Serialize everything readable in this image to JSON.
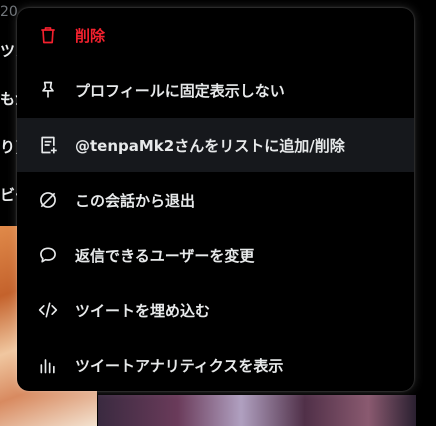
{
  "background": {
    "text_fragments": [
      "20",
      "ツン",
      "もか",
      "り)フ",
      "ビー"
    ]
  },
  "menu": {
    "items": [
      {
        "label": "削除",
        "icon": "trash-icon",
        "danger": true
      },
      {
        "label": "プロフィールに固定表示しない",
        "icon": "pin-icon"
      },
      {
        "label": "@tenpaMk2さんをリストに追加/削除",
        "icon": "list-add-icon",
        "hovered": true
      },
      {
        "label": "この会話から退出",
        "icon": "leave-conversation-icon"
      },
      {
        "label": "返信できるユーザーを変更",
        "icon": "speech-bubble-icon"
      },
      {
        "label": "ツイートを埋め込む",
        "icon": "code-icon"
      },
      {
        "label": "ツイートアナリティクスを表示",
        "icon": "analytics-icon"
      }
    ]
  },
  "colors": {
    "danger": "#f4212e",
    "text": "#e7e9ea",
    "menu_bg": "#000000",
    "hover_bg": "#16181c"
  }
}
